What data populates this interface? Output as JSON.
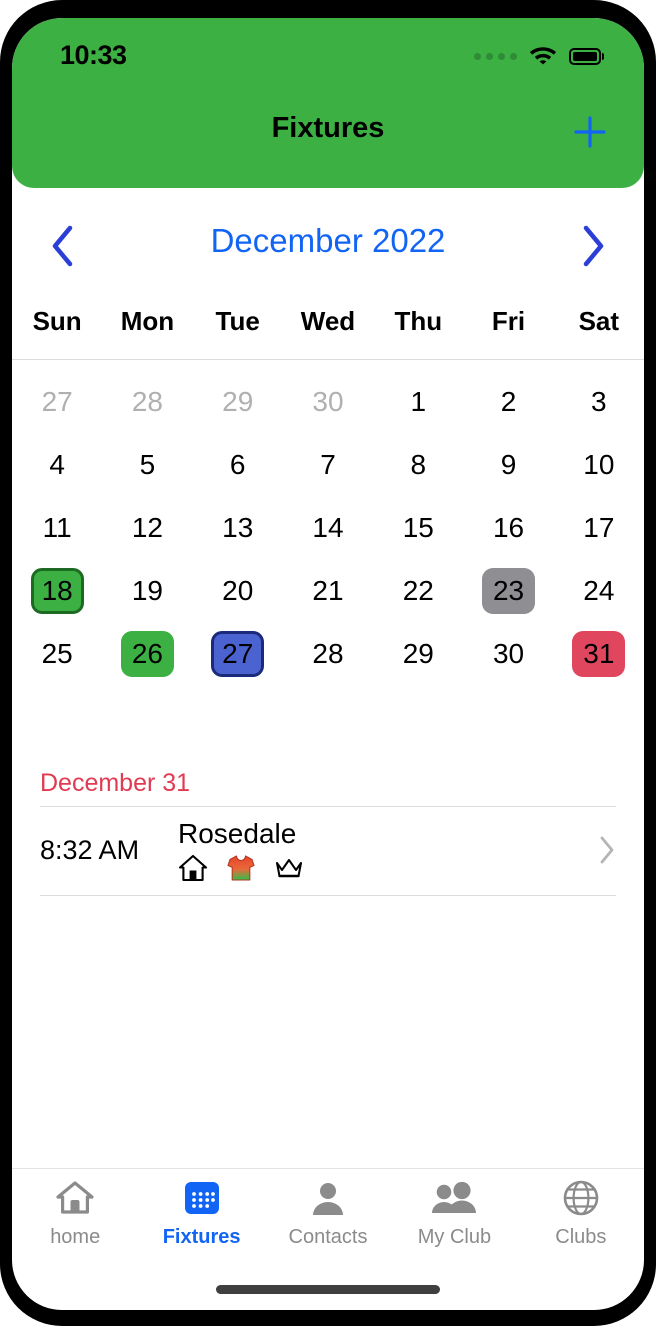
{
  "status_bar": {
    "time": "10:33",
    "signal_icon": "signal-dots-icon",
    "wifi_icon": "wifi-icon",
    "battery_icon": "battery-icon"
  },
  "header": {
    "title": "Fixtures",
    "add_icon": "plus-icon",
    "background_color": "#3cb043",
    "accent_color": "#1264f5"
  },
  "calendar": {
    "month_label": "December 2022",
    "prev_icon": "chevron-left-icon",
    "next_icon": "chevron-right-icon",
    "weekdays": [
      "Sun",
      "Mon",
      "Tue",
      "Wed",
      "Thu",
      "Fri",
      "Sat"
    ],
    "weeks": [
      [
        {
          "day": "27",
          "style": "muted"
        },
        {
          "day": "28",
          "style": "muted"
        },
        {
          "day": "29",
          "style": "muted"
        },
        {
          "day": "30",
          "style": "muted"
        },
        {
          "day": "1",
          "style": "plain"
        },
        {
          "day": "2",
          "style": "plain"
        },
        {
          "day": "3",
          "style": "plain"
        }
      ],
      [
        {
          "day": "4",
          "style": "plain"
        },
        {
          "day": "5",
          "style": "plain"
        },
        {
          "day": "6",
          "style": "plain"
        },
        {
          "day": "7",
          "style": "plain"
        },
        {
          "day": "8",
          "style": "plain"
        },
        {
          "day": "9",
          "style": "plain"
        },
        {
          "day": "10",
          "style": "plain"
        }
      ],
      [
        {
          "day": "11",
          "style": "plain"
        },
        {
          "day": "12",
          "style": "plain"
        },
        {
          "day": "13",
          "style": "plain"
        },
        {
          "day": "14",
          "style": "plain"
        },
        {
          "day": "15",
          "style": "plain"
        },
        {
          "day": "16",
          "style": "plain"
        },
        {
          "day": "17",
          "style": "plain"
        }
      ],
      [
        {
          "day": "18",
          "style": "green-outline"
        },
        {
          "day": "19",
          "style": "plain"
        },
        {
          "day": "20",
          "style": "plain"
        },
        {
          "day": "21",
          "style": "plain"
        },
        {
          "day": "22",
          "style": "plain"
        },
        {
          "day": "23",
          "style": "grey"
        },
        {
          "day": "24",
          "style": "plain"
        }
      ],
      [
        {
          "day": "25",
          "style": "plain"
        },
        {
          "day": "26",
          "style": "green"
        },
        {
          "day": "27",
          "style": "blue-outline"
        },
        {
          "day": "28",
          "style": "plain"
        },
        {
          "day": "29",
          "style": "plain"
        },
        {
          "day": "30",
          "style": "plain"
        },
        {
          "day": "31",
          "style": "red"
        }
      ]
    ],
    "colors": {
      "green": "#3cb043",
      "green_border": "#1d6b22",
      "grey": "#8e8e93",
      "blue": "#4a63d1",
      "blue_border": "#1b2a7a",
      "red": "#e0475f",
      "muted_text": "#b0b0b0"
    }
  },
  "fixtures": {
    "date_heading": "December 31",
    "date_heading_color": "#e03b52",
    "rows": [
      {
        "time": "8:32 AM",
        "name": "Rosedale",
        "badges": [
          "home-icon",
          "jersey-icon",
          "crown-icon"
        ],
        "chevron_icon": "chevron-right-icon"
      }
    ]
  },
  "tab_bar": {
    "active_color": "#1264f5",
    "inactive_color": "#8b8b8b",
    "items": [
      {
        "label": "home",
        "icon": "house-icon",
        "active": false
      },
      {
        "label": "Fixtures",
        "icon": "calendar-icon",
        "active": true
      },
      {
        "label": "Contacts",
        "icon": "person-icon",
        "active": false
      },
      {
        "label": "My Club",
        "icon": "people-icon",
        "active": false
      },
      {
        "label": "Clubs",
        "icon": "globe-icon",
        "active": false
      }
    ]
  }
}
